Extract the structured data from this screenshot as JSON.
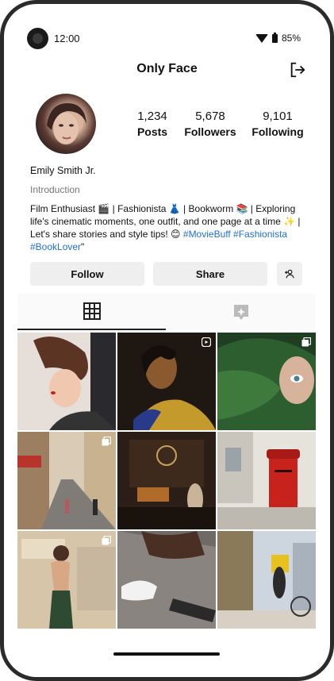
{
  "status_bar": {
    "time": "12:00",
    "battery": "85%",
    "icons": [
      "camera-icon",
      "wifi-icon",
      "battery-icon"
    ]
  },
  "app_bar": {
    "title": "Only Face",
    "action_icon": "logout-icon"
  },
  "profile": {
    "name": "Emily Smith Jr.",
    "intro_label": "Introduction",
    "bio_text": "Film Enthusiast 🎬 | Fashionista 👗 | Bookworm 📚 | Exploring life's cinematic moments, one outfit, and one page at a time ✨ | Let's share stories and style tips! 😊 ",
    "bio_tags": "#MovieBuff #Fashionista #BookLover",
    "bio_end": "\"",
    "stats": [
      {
        "value": "1,234",
        "label": "Posts"
      },
      {
        "value": "5,678",
        "label": "Followers"
      },
      {
        "value": "9,101",
        "label": "Following"
      }
    ]
  },
  "actions": {
    "follow_label": "Follow",
    "share_label": "Share",
    "add_icon": "add-person-icon"
  },
  "tabs": [
    {
      "icon": "grid-icon",
      "active": true
    },
    {
      "icon": "tagged-icon",
      "active": false
    }
  ],
  "posts": [
    {
      "subject": "woman-portrait",
      "badge": null
    },
    {
      "subject": "woman-shadow",
      "badge": "reel-icon"
    },
    {
      "subject": "face-behind-leaf",
      "badge": "multi-icon"
    },
    {
      "subject": "city-street",
      "badge": "multi-icon"
    },
    {
      "subject": "cafe-storefront",
      "badge": null
    },
    {
      "subject": "red-postbox",
      "badge": null
    },
    {
      "subject": "vintage-woman",
      "badge": "multi-icon"
    },
    {
      "subject": "sneakers-skateboard",
      "badge": null
    },
    {
      "subject": "delivery-cyclist",
      "badge": null
    }
  ],
  "colors": {
    "hashtag": "#1e6fd6",
    "button_bg": "#efefef",
    "frame": "#2b2b2b"
  }
}
